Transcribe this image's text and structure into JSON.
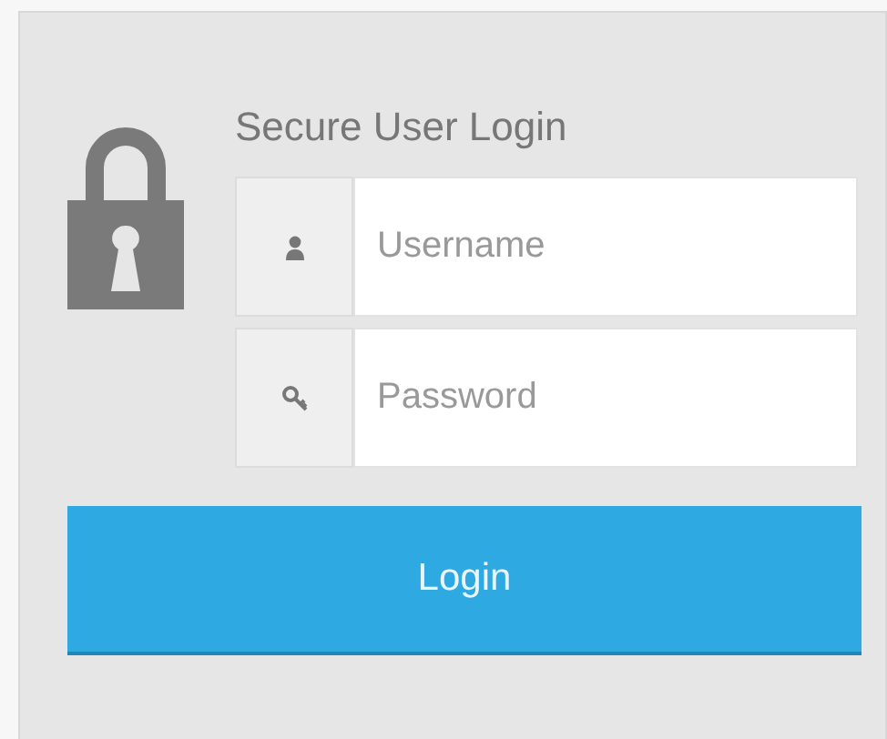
{
  "title": "Secure User Login",
  "fields": [
    {
      "kind": "user",
      "placeholder": "Username"
    },
    {
      "kind": "password",
      "placeholder": "Password"
    }
  ],
  "button": "Login"
}
